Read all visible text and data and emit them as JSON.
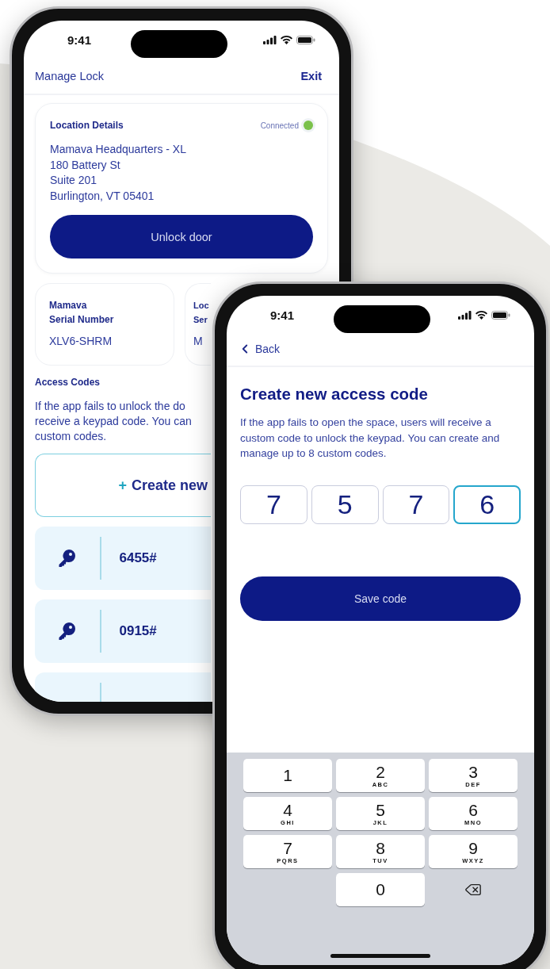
{
  "back_phone": {
    "status_bar": {
      "time": "9:41"
    },
    "nav": {
      "title": "Manage Lock",
      "action": "Exit"
    },
    "location_card": {
      "heading": "Location Details",
      "status": "Connected",
      "connected": true,
      "address_lines": [
        "Mamava Headquarters - XL",
        "180 Battery St",
        "Suite 201",
        "Burlington, VT 05401"
      ],
      "button": "Unlock door"
    },
    "info_cards": [
      {
        "label_lines": [
          "Mamava",
          "Serial Number"
        ],
        "value": "XLV6-SHRM"
      },
      {
        "label_lines": [
          "Loc",
          "Ser"
        ],
        "value": "M"
      }
    ],
    "access_codes": {
      "heading": "Access Codes",
      "description_lines": [
        "If the app fails to unlock the do",
        "receive a keypad code. You can",
        "custom codes."
      ],
      "create_icon": "+",
      "create_label": "Create new",
      "codes": [
        {
          "code": "6455#"
        },
        {
          "code": "0915#"
        }
      ]
    }
  },
  "front_phone": {
    "status_bar": {
      "time": "9:41"
    },
    "back_label": "Back",
    "title": "Create new access code",
    "description": "If the app fails to open the space, users will receive a custom code to unlock the keypad. You can create and manage up to 8 custom codes.",
    "code_digits": [
      {
        "value": "7",
        "selected": false
      },
      {
        "value": "5",
        "selected": false
      },
      {
        "value": "7",
        "selected": false
      },
      {
        "value": "6",
        "selected": true
      }
    ],
    "save_button": "Save code",
    "keypad": [
      {
        "kind": "digit",
        "digit": "1"
      },
      {
        "kind": "digit",
        "digit": "2",
        "letters": "ABC"
      },
      {
        "kind": "digit",
        "digit": "3",
        "letters": "DEF"
      },
      {
        "kind": "digit",
        "digit": "4",
        "letters": "GHI"
      },
      {
        "kind": "digit",
        "digit": "5",
        "letters": "JKL"
      },
      {
        "kind": "digit",
        "digit": "6",
        "letters": "MNO"
      },
      {
        "kind": "digit",
        "digit": "7",
        "letters": "PQRS"
      },
      {
        "kind": "digit",
        "digit": "8",
        "letters": "TUV"
      },
      {
        "kind": "digit",
        "digit": "9",
        "letters": "WXYZ"
      },
      {
        "kind": "blank"
      },
      {
        "kind": "digit",
        "digit": "0"
      },
      {
        "kind": "backspace"
      }
    ]
  }
}
